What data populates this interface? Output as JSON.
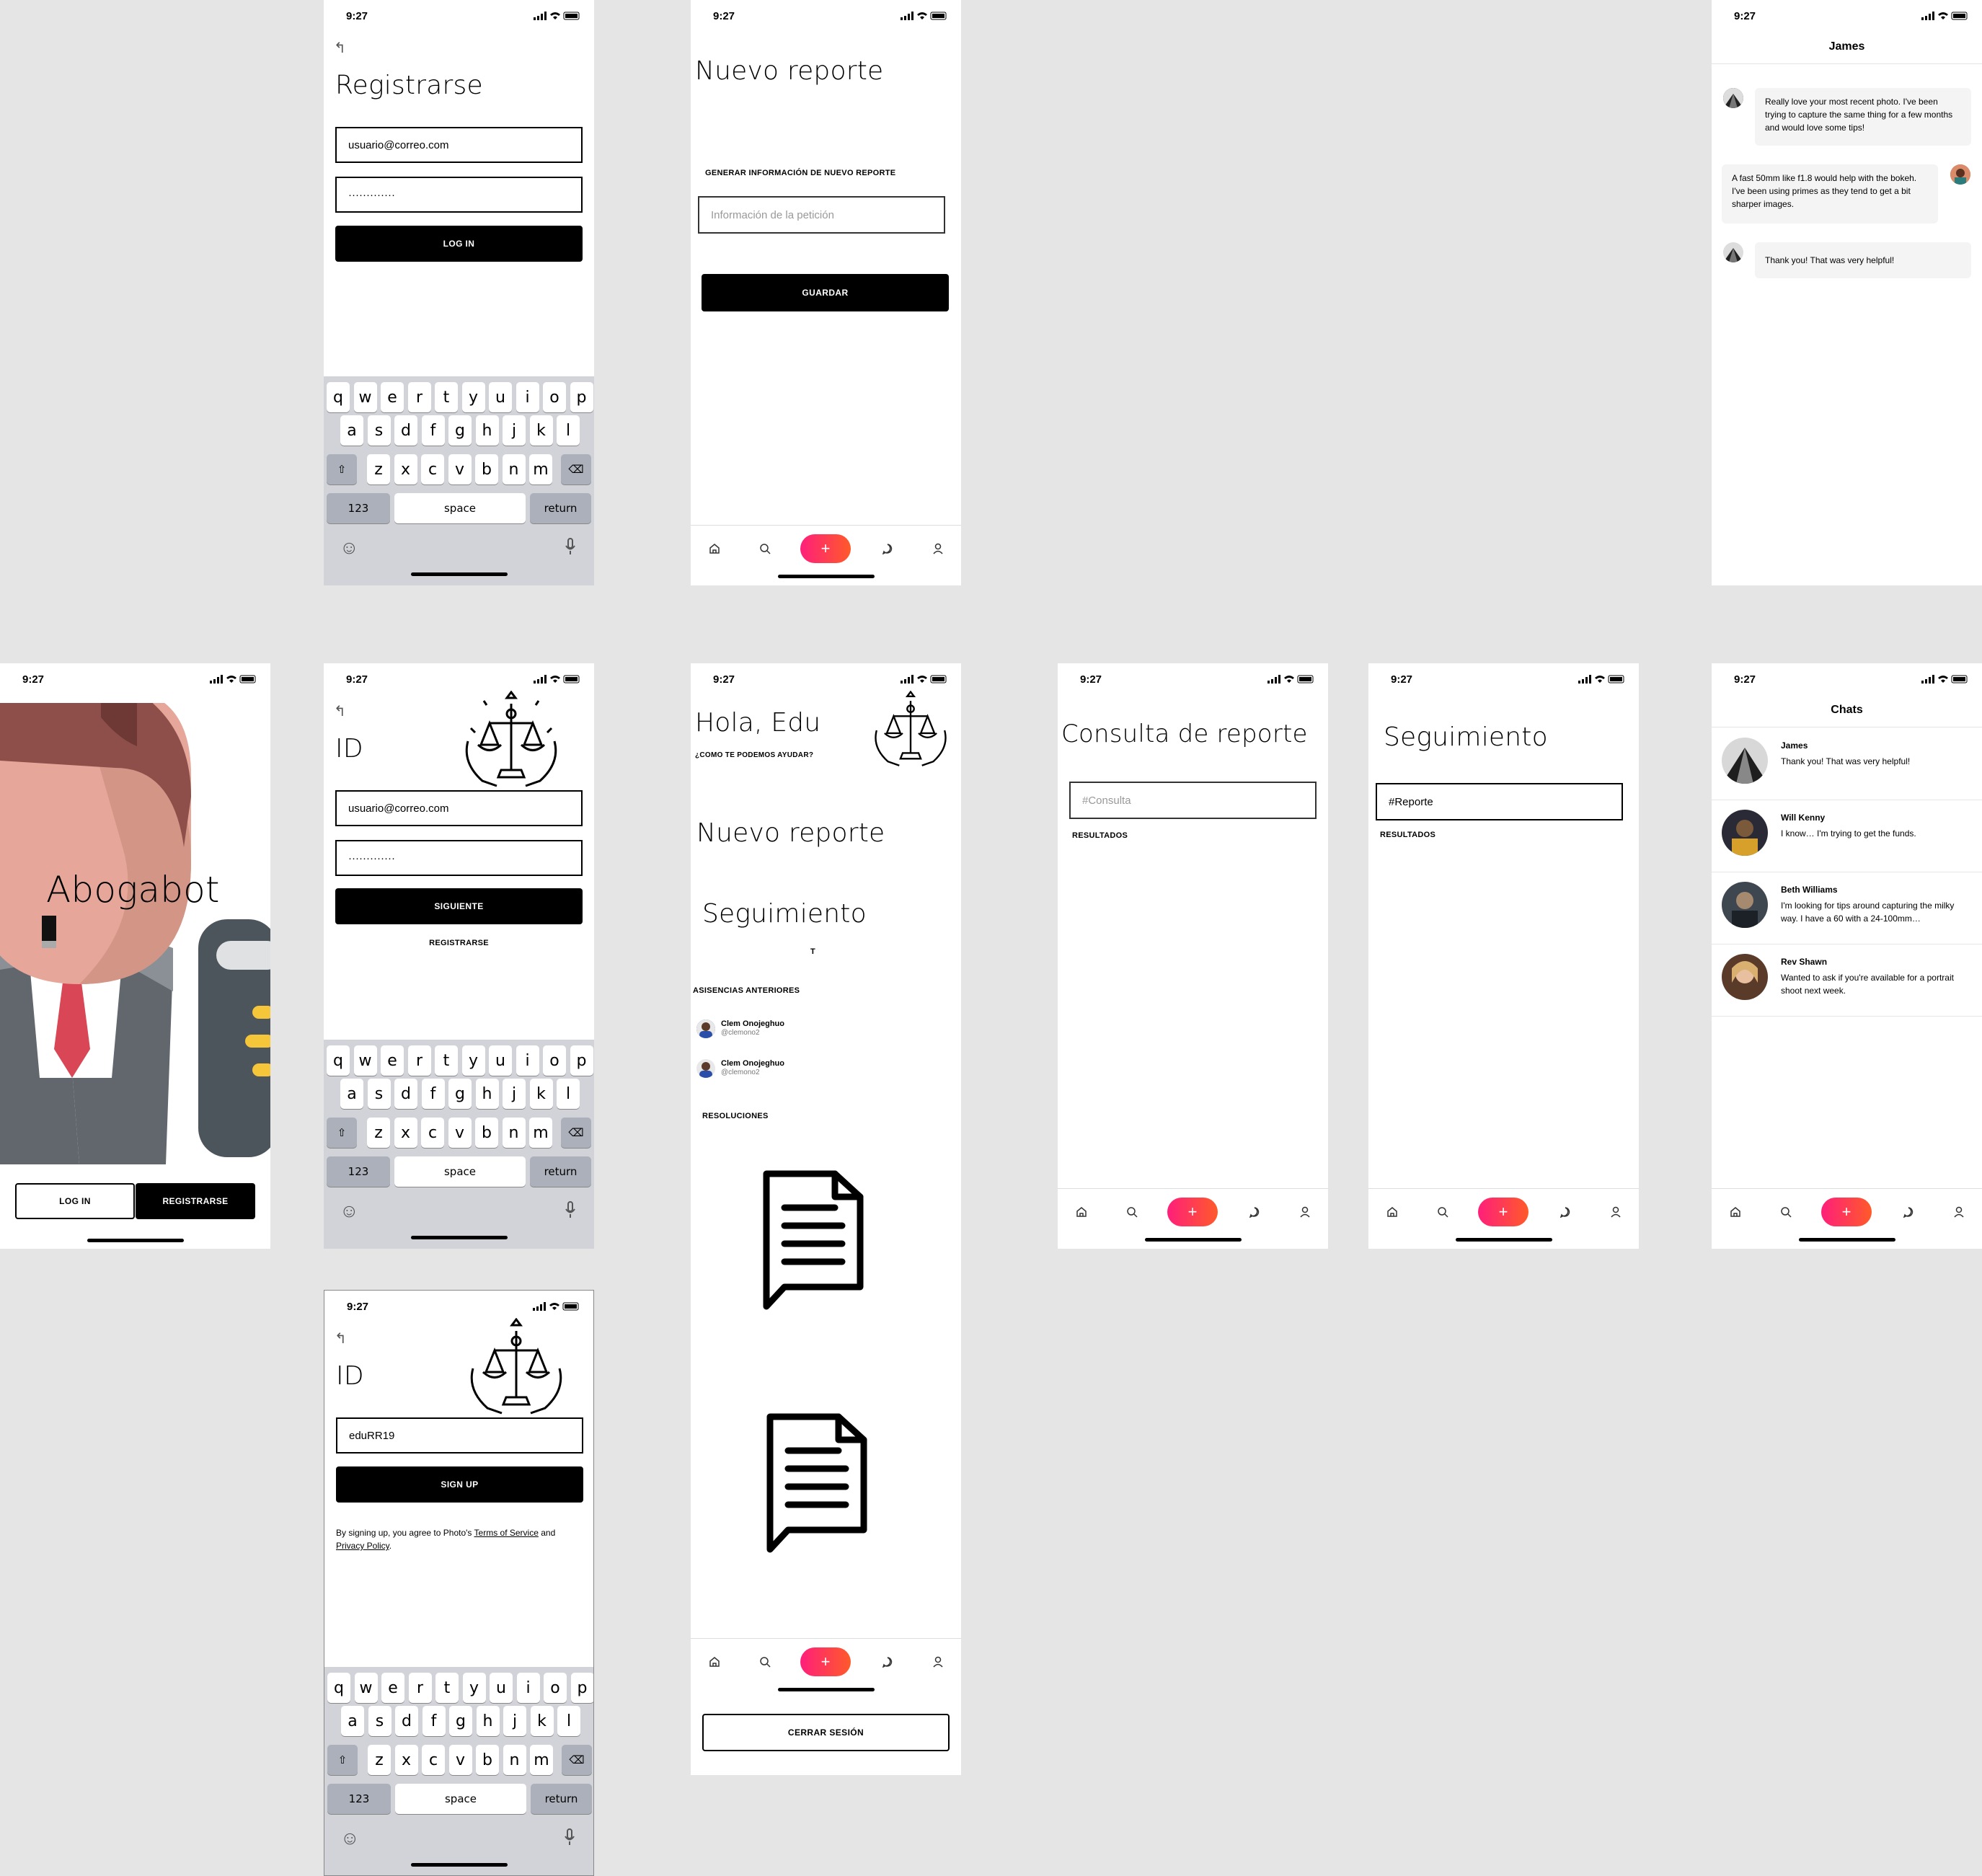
{
  "status": {
    "time": "9:27"
  },
  "keyboard": {
    "row1": [
      "q",
      "w",
      "e",
      "r",
      "t",
      "y",
      "u",
      "i",
      "o",
      "p"
    ],
    "row2": [
      "a",
      "s",
      "d",
      "f",
      "g",
      "h",
      "j",
      "k",
      "l"
    ],
    "row3": [
      "z",
      "x",
      "c",
      "v",
      "b",
      "n",
      "m"
    ],
    "num": "123",
    "space": "space",
    "ret": "return"
  },
  "registrarse": {
    "back": "↰",
    "title": "Registrarse",
    "email": "usuario@correo.com",
    "password": "·············",
    "login": "LOG IN"
  },
  "nuevo": {
    "title": "Nuevo reporte",
    "caption": "GENERAR INFORMACIÓN DE NUEVO REPORTE",
    "placeholder": "Información de la petición",
    "save": "GUARDAR"
  },
  "chat_james": {
    "header": "James",
    "m1": "Really love your most recent photo. I've been trying to capture the same thing for a few months and would love some tips!",
    "m2": "A fast 50mm like f1.8 would help with the bokeh. I've been using primes as they tend to get a bit sharper images.",
    "m3": "Thank you! That was very helpful!"
  },
  "splash": {
    "title": "Abogabot",
    "login": "LOG IN",
    "register": "REGISTRARSE"
  },
  "id_login": {
    "back": "↰",
    "title": "ID",
    "email": "usuario@correo.com",
    "password": "·············",
    "next": "SIGUIENTE",
    "register": "REGISTRARSE"
  },
  "home": {
    "greeting": "Hola, Edu",
    "sub": "¿COMO TE PODEMOS AYUDAR?",
    "new_report": "Nuevo reporte",
    "follow": "Seguimiento",
    "t": "T",
    "previous": "ASISENCIAS ANTERIORES",
    "people": [
      {
        "name": "Clem Onojeghuo",
        "handle": "@clemono2"
      },
      {
        "name": "Clem Onojeghuo",
        "handle": "@clemono2"
      }
    ],
    "resolutions": "RESOLUCIONES",
    "logout": "CERRAR SESIÓN"
  },
  "consulta": {
    "title": "Consulta de reporte",
    "placeholder": "#Consulta",
    "results": "RESULTADOS"
  },
  "seguimiento": {
    "title": "Seguimiento",
    "value": "#Reporte",
    "results": "RESULTADOS"
  },
  "chats": {
    "header": "Chats",
    "items": [
      {
        "name": "James",
        "msg": "Thank you! That was very helpful!"
      },
      {
        "name": "Will Kenny",
        "msg": "I know… I'm trying to get the funds."
      },
      {
        "name": "Beth Williams",
        "msg": "I'm looking for tips around capturing the milky way. I have a 60 with a 24-100mm…"
      },
      {
        "name": "Rev Shawn",
        "msg": "Wanted to ask if you're available for a portrait shoot next week."
      }
    ]
  },
  "signup": {
    "back": "↰",
    "title": "ID",
    "value": "eduRR19",
    "button": "SIGN UP",
    "terms_pre": "By signing up, you agree to Photo's ",
    "terms_link": "Terms of Service",
    "terms_and": " and",
    "privacy": "Privacy Policy",
    "terms_end": "."
  }
}
